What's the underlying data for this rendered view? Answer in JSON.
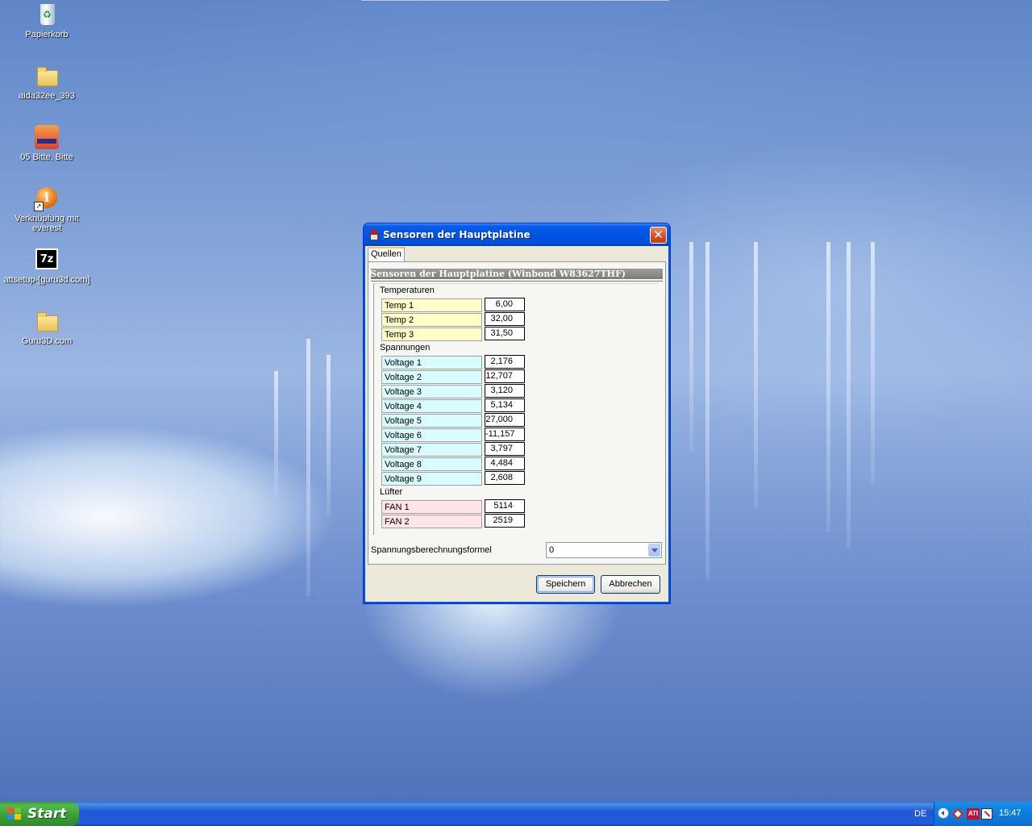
{
  "desktop": {
    "icons": [
      {
        "label": "Papierkorb",
        "icon": "recycle-bin-icon"
      },
      {
        "label": "aida32ee_393",
        "icon": "folder-icon"
      },
      {
        "label": "05 Bitte, Bitte",
        "icon": "media-file-icon"
      },
      {
        "label": "Verknüpfung mit everest",
        "icon": "everest-icon"
      },
      {
        "label": "attsetup-[guru3d.com]",
        "icon": "7zip-archive-icon"
      },
      {
        "label": "Guru3D.com",
        "icon": "folder-icon"
      }
    ]
  },
  "window": {
    "title": "Sensoren der Hauptplatine",
    "tab": "Quellen",
    "panel_title": "Sensoren der Hauptplatine (Winbond W83627THF)",
    "groups": {
      "temperatures": {
        "label": "Temperaturen",
        "rows": [
          {
            "label": "Temp 1",
            "value": "6,00"
          },
          {
            "label": "Temp 2",
            "value": "32,00"
          },
          {
            "label": "Temp 3",
            "value": "31,50"
          }
        ]
      },
      "voltages": {
        "label": "Spannungen",
        "rows": [
          {
            "label": "Voltage 1",
            "value": "2,176"
          },
          {
            "label": "Voltage 2",
            "value": "12,707"
          },
          {
            "label": "Voltage 3",
            "value": "3,120"
          },
          {
            "label": "Voltage 4",
            "value": "5,134"
          },
          {
            "label": "Voltage 5",
            "value": "27,000"
          },
          {
            "label": "Voltage 6",
            "value": "-11,157"
          },
          {
            "label": "Voltage 7",
            "value": "3,797"
          },
          {
            "label": "Voltage 8",
            "value": "4,484"
          },
          {
            "label": "Voltage 9",
            "value": "2,608"
          }
        ]
      },
      "fans": {
        "label": "Lüfter",
        "rows": [
          {
            "label": "FAN 1",
            "value": "5114"
          },
          {
            "label": "FAN 2",
            "value": "2519"
          }
        ]
      }
    },
    "formula_label": "Spannungsberechnungsformel",
    "formula_value": "0",
    "save_label": "Speichern",
    "cancel_label": "Abbrechen",
    "colors": {
      "temp_bg": "#ffffc8",
      "volt_bg": "#d8fcff",
      "fan_bg": "#ffe4e8"
    }
  },
  "taskbar": {
    "start_label": "Start",
    "language": "DE",
    "clock": "15:47",
    "tray_badge": "ATI"
  }
}
